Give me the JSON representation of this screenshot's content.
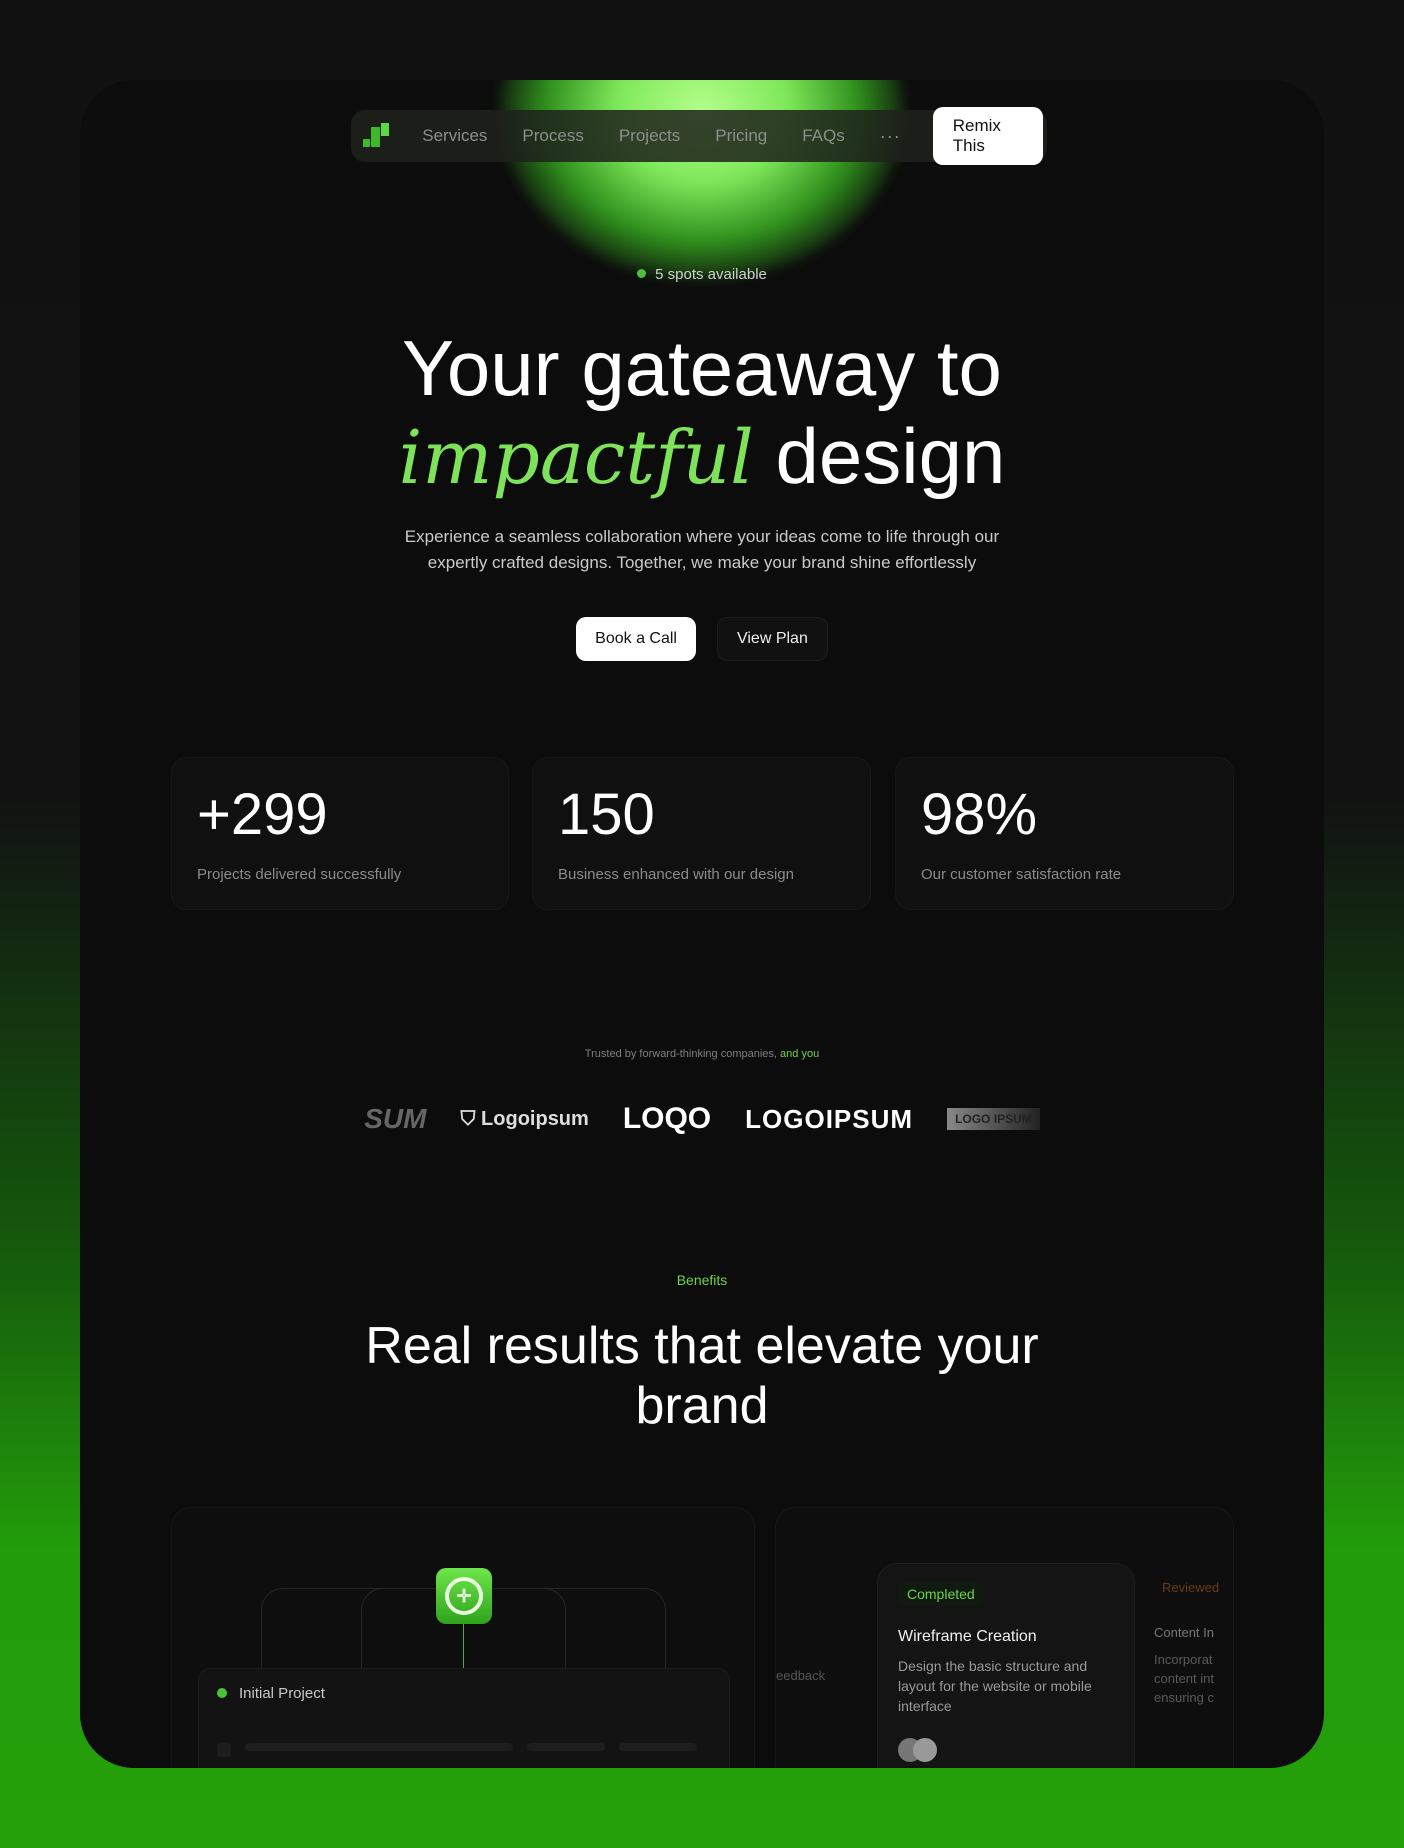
{
  "nav": {
    "items": [
      "Services",
      "Process",
      "Projects",
      "Pricing",
      "FAQs"
    ],
    "more": "···",
    "cta": "Remix This"
  },
  "hero": {
    "badge": "5 spots available",
    "title_line1": "Your gateaway to",
    "title_accent": "impactful",
    "title_rest": "design",
    "description_line1": "Experience a seamless collaboration where your ideas come to life through our",
    "description_line2": "expertly crafted designs. Together, we make your brand shine effortlessly",
    "primary_button": "Book a Call",
    "secondary_button": "View Plan"
  },
  "stats": [
    {
      "value": "+299",
      "label": "Projects delivered successfully"
    },
    {
      "value": "150",
      "label": "Business enhanced with our design"
    },
    {
      "value": "98%",
      "label": "Our customer satisfaction rate"
    }
  ],
  "trusted": {
    "text": "Trusted by forward-thinking companies,",
    "accent": "and you"
  },
  "logos": [
    "SUM",
    "Logoipsum",
    "LOQO",
    "LOGOIPSUM",
    "LOGO IPSUM"
  ],
  "benefits": {
    "eyebrow": "Benefits",
    "title_line1": "Real results that elevate your",
    "title_line2": "brand"
  },
  "preview": {
    "project": "Initial Project",
    "status": "Completed",
    "task_title": "Wireframe Creation",
    "task_desc": "Design the basic structure and layout for the website or mobile interface",
    "left_partial": "eedback",
    "right_status": "Reviewed",
    "right_title": "Content In",
    "right_desc": "Incorporat content int ensuring c"
  },
  "colors": {
    "accent": "#6fd24c",
    "background": "#0c0c0c",
    "outer_green": "#24a00a"
  }
}
